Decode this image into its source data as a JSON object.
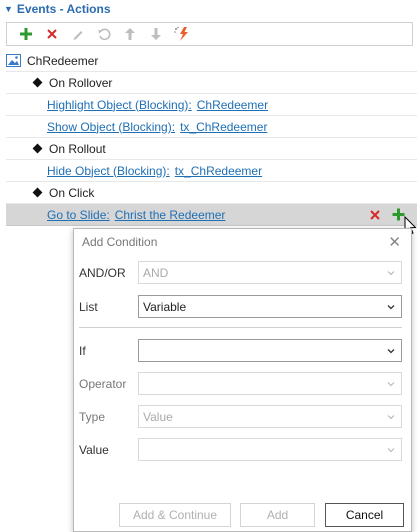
{
  "panel": {
    "title": "Events - Actions"
  },
  "toolbar": {
    "buttons": [
      "add-icon",
      "delete-icon",
      "edit-icon",
      "undo-icon",
      "move-up-icon",
      "move-down-icon",
      "magic-wand-icon"
    ]
  },
  "tree": {
    "root": "ChRedeemer",
    "events": [
      {
        "label": "On Rollover",
        "actions": [
          {
            "action": "Highlight Object (Blocking):",
            "target": "ChRedeemer"
          },
          {
            "action": "Show Object (Blocking):",
            "target": "tx_ChRedeemer"
          }
        ]
      },
      {
        "label": "On Rollout",
        "actions": [
          {
            "action": "Hide Object (Blocking):",
            "target": "tx_ChRedeemer"
          }
        ]
      },
      {
        "label": "On Click",
        "actions": [
          {
            "action": "Go to Slide:",
            "target": "Christ the Redeemer"
          }
        ]
      }
    ]
  },
  "dialog": {
    "title": "Add Condition",
    "fields": {
      "andor": {
        "label": "AND/OR",
        "value": "AND"
      },
      "list": {
        "label": "List",
        "value": "Variable"
      },
      "if": {
        "label": "If",
        "value": ""
      },
      "operator": {
        "label": "Operator",
        "value": ""
      },
      "type": {
        "label": "Type",
        "value": "Value"
      },
      "value": {
        "label": "Value",
        "value": ""
      }
    },
    "buttons": {
      "add_continue": "Add & Continue",
      "add": "Add",
      "cancel": "Cancel"
    }
  },
  "colors": {
    "accent": "#2b6cb0",
    "link": "#1f6fb4",
    "add_green": "#2e9a2e",
    "delete_red": "#d62b2b"
  }
}
